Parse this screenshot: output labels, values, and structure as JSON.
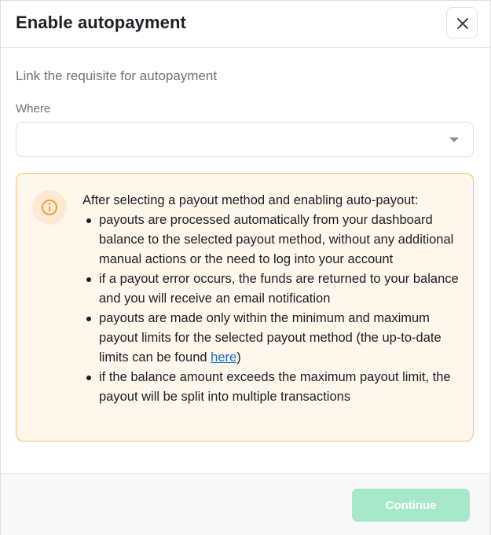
{
  "dialog": {
    "title": "Enable autopayment",
    "close_icon": "close-icon"
  },
  "form": {
    "subtitle": "Link the requisite for autopayment",
    "where_label": "Where",
    "where_value": "",
    "dropdown_icon": "chevron-down-icon"
  },
  "info": {
    "icon": "info-icon",
    "heading": "After selecting a payout method and enabling auto-payout:",
    "bullets": [
      "payouts are processed automatically from your dashboard balance to the selected payout method, without any additional manual actions or the need to log into your account",
      "if a payout error occurs, the funds are returned to your balance and you will receive an email notification",
      "payouts are made only within the minimum and maximum payout limits for the selected payout method (the up-to-date limits can be found ",
      "if the balance amount exceeds the maximum payout limit, the payout will be split into multiple transactions"
    ],
    "link_text": "here",
    "link_suffix": ")"
  },
  "footer": {
    "continue_label": "Continue"
  },
  "colors": {
    "info_border": "#f0c46f",
    "info_background": "#fff6ec",
    "info_icon": "#f0a03c",
    "continue_disabled": "#a6e8c9",
    "link": "#1d6fc4"
  }
}
